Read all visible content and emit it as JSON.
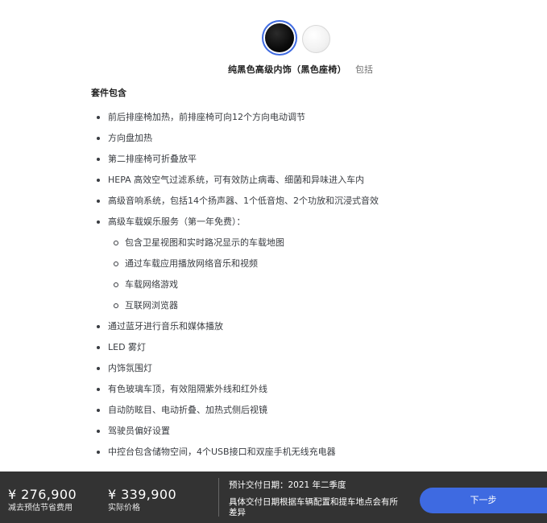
{
  "interior": {
    "swatches": [
      {
        "name": "black-interior",
        "color": "#000000",
        "selected": true
      },
      {
        "name": "white-interior",
        "color": "#f2f2f2",
        "selected": false
      }
    ],
    "name": "纯黑色高级内饰（黑色座椅）",
    "price": "包括"
  },
  "package": {
    "title": "套件包含",
    "features": [
      "前后排座椅加热，前排座椅可向12个方向电动调节",
      "方向盘加热",
      "第二排座椅可折叠放平",
      "HEPA 高效空气过滤系统，可有效防止病毒、细菌和异味进入车内",
      "高级音响系统，包括14个扬声器、1个低音炮、2个功放和沉浸式音效",
      "高级车载娱乐服务（第一年免费）："
    ],
    "services": [
      "包含卫星视图和实时路况显示的车载地图",
      "通过车载应用播放网络音乐和视频",
      "车载网络游戏",
      "互联网浏览器"
    ],
    "features_more": [
      "通过蓝牙进行音乐和媒体播放",
      "LED 雾灯",
      "内饰氛围灯",
      "有色玻璃车顶，有效阻隔紫外线和红外线",
      "自动防眩目、电动折叠、加热式侧后视镜",
      "驾驶员偏好设置",
      "中控台包含储物空间，4个USB接口和双座手机无线充电器"
    ]
  },
  "footer": {
    "savings_price": "¥ 276,900",
    "savings_label": "减去预估节省费用",
    "actual_price": "¥ 339,900",
    "actual_label": "实际价格",
    "delivery_estimate": "预计交付日期：2021 年二季度",
    "delivery_note": "具体交付日期根据车辆配置和提车地点会有所差异",
    "next_label": "下一步",
    "accent_color": "#3e6ae1",
    "background_color": "#333333"
  }
}
